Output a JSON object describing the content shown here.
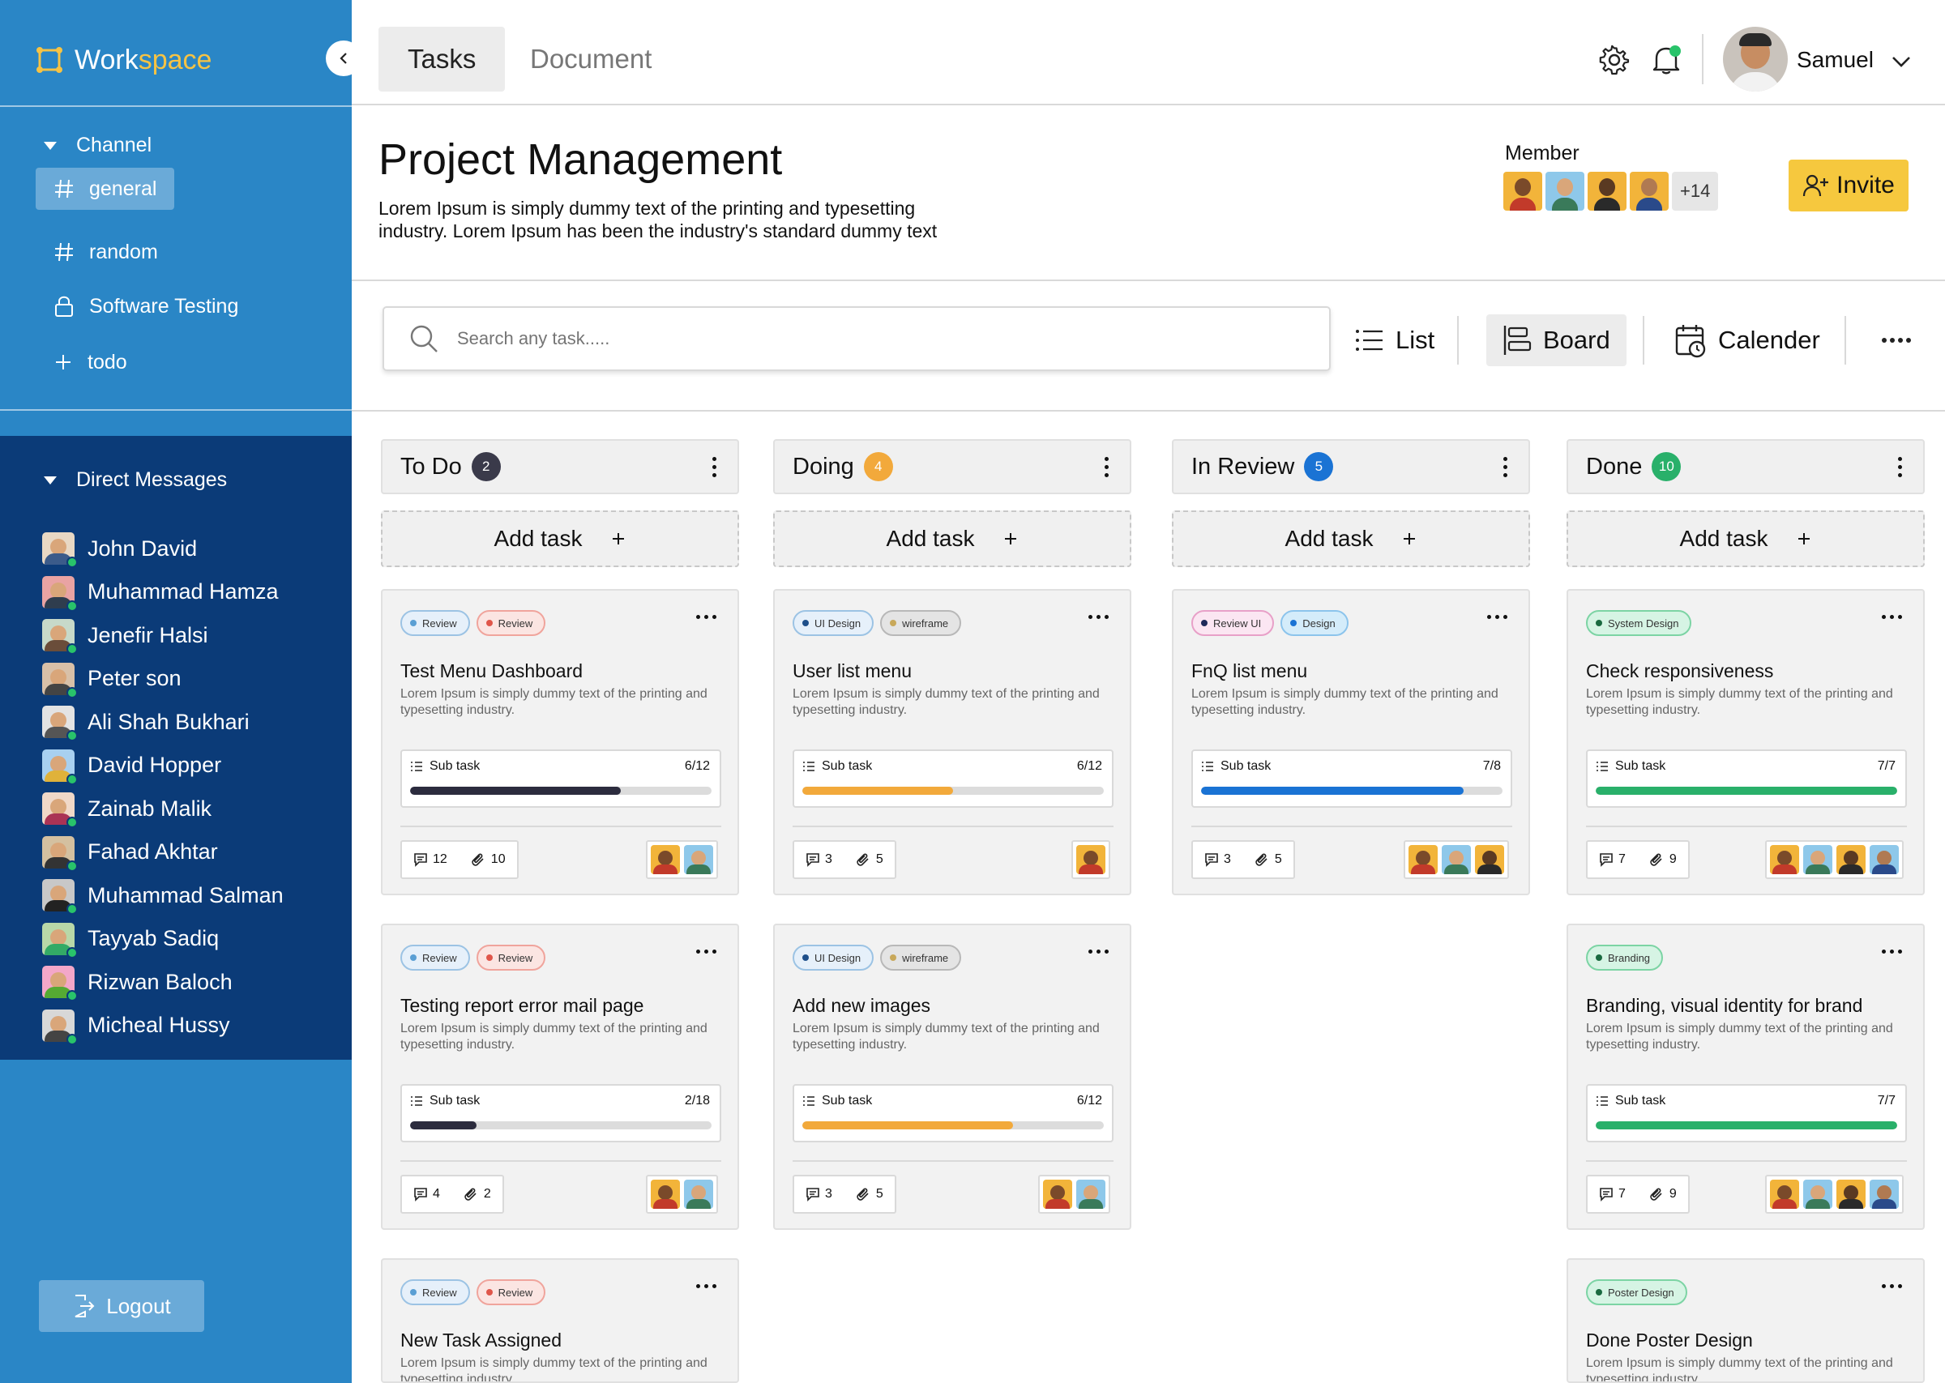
{
  "app": {
    "brand_part1": "Work",
    "brand_part2": "space"
  },
  "sidebar": {
    "channel_heading": "Channel",
    "channels": [
      {
        "label": "general",
        "icon": "hash-icon",
        "active": true
      },
      {
        "label": "random",
        "icon": "hash-icon",
        "active": false
      },
      {
        "label": "Software Testing",
        "icon": "lock-icon",
        "active": false
      },
      {
        "label": "todo",
        "icon": "plus-icon",
        "active": false
      }
    ],
    "dm_heading": "Direct Messages",
    "dms": [
      {
        "name": "John David",
        "avatar_bg": "#e8d8c4",
        "shirt": "#3b5b8a"
      },
      {
        "name": "Muhammad Hamza",
        "avatar_bg": "#e9a3a3",
        "shirt": "#2f3d4e"
      },
      {
        "name": "Jenefir Halsi",
        "avatar_bg": "#c7d9c9",
        "shirt": "#6a4d3a"
      },
      {
        "name": "Peter son",
        "avatar_bg": "#d8c0a8",
        "shirt": "#444"
      },
      {
        "name": "Ali Shah Bukhari",
        "avatar_bg": "#e3e3e3",
        "shirt": "#555"
      },
      {
        "name": "David Hopper",
        "avatar_bg": "#a8d0f0",
        "shirt": "#e0b23a"
      },
      {
        "name": "Zainab Malik",
        "avatar_bg": "#f0d8c8",
        "shirt": "#a35"
      },
      {
        "name": "Fahad Akhtar",
        "avatar_bg": "#d4c0a0",
        "shirt": "#333"
      },
      {
        "name": "Muhammad Salman",
        "avatar_bg": "#c8c8c8",
        "shirt": "#222"
      },
      {
        "name": "Tayyab Sadiq",
        "avatar_bg": "#b8d8a8",
        "shirt": "#3a6"
      },
      {
        "name": "Rizwan Baloch",
        "avatar_bg": "#f3a7c9",
        "shirt": "#5a3"
      },
      {
        "name": "Micheal Hussy",
        "avatar_bg": "#d8d8d8",
        "shirt": "#444"
      }
    ],
    "logout_label": "Logout"
  },
  "topbar": {
    "tabs": [
      {
        "label": "Tasks",
        "active": true
      },
      {
        "label": "Document",
        "active": false
      }
    ],
    "user_name": "Samuel"
  },
  "header": {
    "title": "Project Management",
    "description": "Lorem Ipsum is simply dummy text of the printing and typesetting industry. Lorem Ipsum has been the industry's standard dummy text",
    "member_label": "Member",
    "member_more": "+14",
    "invite_label": "Invite"
  },
  "toolbar": {
    "search_placeholder": "Search any task.....",
    "views": [
      {
        "label": "List",
        "icon": "list-icon",
        "active": false
      },
      {
        "label": "Board",
        "icon": "board-icon",
        "active": true
      },
      {
        "label": "Calender",
        "icon": "calendar-icon",
        "active": false
      }
    ]
  },
  "board": {
    "add_task_label": "Add task",
    "columns": [
      {
        "name": "To Do",
        "count": "2",
        "badge_color": "#3a3a4a",
        "cards": [
          {
            "tags": [
              {
                "label": "Review",
                "dot": "#5a9fd4",
                "border": "#9cc3e4",
                "bg": "#e6f0fa"
              },
              {
                "label": "Review",
                "dot": "#e0564a",
                "border": "#f0a49c",
                "bg": "#fbe5e2"
              }
            ],
            "title": "Test Menu Dashboard",
            "desc": "Lorem Ipsum is simply dummy text of the printing and typesetting industry.",
            "subtask_label": "Sub task",
            "subtask_count": "6/12",
            "progress": 0.7,
            "bar_color": "#2c2c3e",
            "comments": "12",
            "attachments": "10",
            "assignees": 2
          },
          {
            "tags": [
              {
                "label": "Review",
                "dot": "#5a9fd4",
                "border": "#9cc3e4",
                "bg": "#e6f0fa"
              },
              {
                "label": "Review",
                "dot": "#e0564a",
                "border": "#f0a49c",
                "bg": "#fbe5e2"
              }
            ],
            "title": "Testing report error mail page",
            "desc": "Lorem Ipsum is simply dummy text of the printing and typesetting industry.",
            "subtask_label": "Sub task",
            "subtask_count": "2/18",
            "progress": 0.22,
            "bar_color": "#2c2c3e",
            "comments": "4",
            "attachments": "2",
            "assignees": 2
          },
          {
            "tags": [
              {
                "label": "Review",
                "dot": "#5a9fd4",
                "border": "#9cc3e4",
                "bg": "#e6f0fa"
              },
              {
                "label": "Review",
                "dot": "#e0564a",
                "border": "#f0a49c",
                "bg": "#fbe5e2"
              }
            ],
            "title": "New Task Assigned",
            "desc": "Lorem Ipsum is simply dummy text of the printing and typesetting industry.",
            "subtask_label": "",
            "subtask_count": "",
            "progress": 0,
            "bar_color": "#2c2c3e",
            "comments": "",
            "attachments": "",
            "assignees": 0
          }
        ]
      },
      {
        "name": "Doing",
        "count": "4",
        "badge_color": "#f2a93b",
        "cards": [
          {
            "tags": [
              {
                "label": "UI Design",
                "dot": "#1e4f8a",
                "border": "#9cc3e4",
                "bg": "#e6f0fa"
              },
              {
                "label": "wireframe",
                "dot": "#c8a85a",
                "border": "#b8b8b8",
                "bg": "#e4e4e4"
              }
            ],
            "title": "User list menu",
            "desc": "Lorem Ipsum is simply dummy text of the printing and typesetting industry.",
            "subtask_label": "Sub task",
            "subtask_count": "6/12",
            "progress": 0.5,
            "bar_color": "#f2a93b",
            "comments": "3",
            "attachments": "5",
            "assignees": 1
          },
          {
            "tags": [
              {
                "label": "UI Design",
                "dot": "#1e4f8a",
                "border": "#9cc3e4",
                "bg": "#e6f0fa"
              },
              {
                "label": "wireframe",
                "dot": "#c8a85a",
                "border": "#b8b8b8",
                "bg": "#e4e4e4"
              }
            ],
            "title": "Add new images",
            "desc": "Lorem Ipsum is simply dummy text of the printing and typesetting industry.",
            "subtask_label": "Sub task",
            "subtask_count": "6/12",
            "progress": 0.7,
            "bar_color": "#f2a93b",
            "comments": "3",
            "attachments": "5",
            "assignees": 2
          }
        ]
      },
      {
        "name": "In Review",
        "count": "5",
        "badge_color": "#1a73d4",
        "cards": [
          {
            "tags": [
              {
                "label": "Review UI",
                "dot": "#1e2a5a",
                "border": "#e8a0c8",
                "bg": "#fbe6f2"
              },
              {
                "label": "Design",
                "dot": "#1a73d4",
                "border": "#8cc4ec",
                "bg": "#d4ecfa"
              }
            ],
            "title": "FnQ list menu",
            "desc": "Lorem Ipsum is simply dummy text of the printing and typesetting industry.",
            "subtask_label": "Sub task",
            "subtask_count": "7/8",
            "progress": 0.87,
            "bar_color": "#1a73d4",
            "comments": "3",
            "attachments": "5",
            "assignees": 3
          }
        ]
      },
      {
        "name": "Done",
        "count": "10",
        "badge_color": "#29b06a",
        "cards": [
          {
            "tags": [
              {
                "label": "System Design",
                "dot": "#1a6a40",
                "border": "#7cd4a4",
                "bg": "#d6f4e4"
              }
            ],
            "title": "Check responsiveness",
            "desc": "Lorem Ipsum is simply dummy text of the printing and typesetting industry.",
            "subtask_label": "Sub task",
            "subtask_count": "7/7",
            "progress": 1,
            "bar_color": "#29b06a",
            "comments": "7",
            "attachments": "9",
            "assignees": 4
          },
          {
            "tags": [
              {
                "label": "Branding",
                "dot": "#1a6a40",
                "border": "#7cd4a4",
                "bg": "#d6f4e4"
              }
            ],
            "title": "Branding, visual identity for brand",
            "desc": "Lorem Ipsum is simply dummy text of the printing and typesetting industry.",
            "subtask_label": "Sub task",
            "subtask_count": "7/7",
            "progress": 1,
            "bar_color": "#29b06a",
            "comments": "7",
            "attachments": "9",
            "assignees": 4
          },
          {
            "tags": [
              {
                "label": "Poster Design",
                "dot": "#1a6a40",
                "border": "#7cd4a4",
                "bg": "#d6f4e4"
              }
            ],
            "title": "Done Poster Design",
            "desc": "Lorem Ipsum is simply dummy text of the printing and typesetting industry.",
            "subtask_label": "",
            "subtask_count": "",
            "progress": 0,
            "bar_color": "#29b06a",
            "comments": "",
            "attachments": "",
            "assignees": 0
          }
        ]
      }
    ]
  }
}
